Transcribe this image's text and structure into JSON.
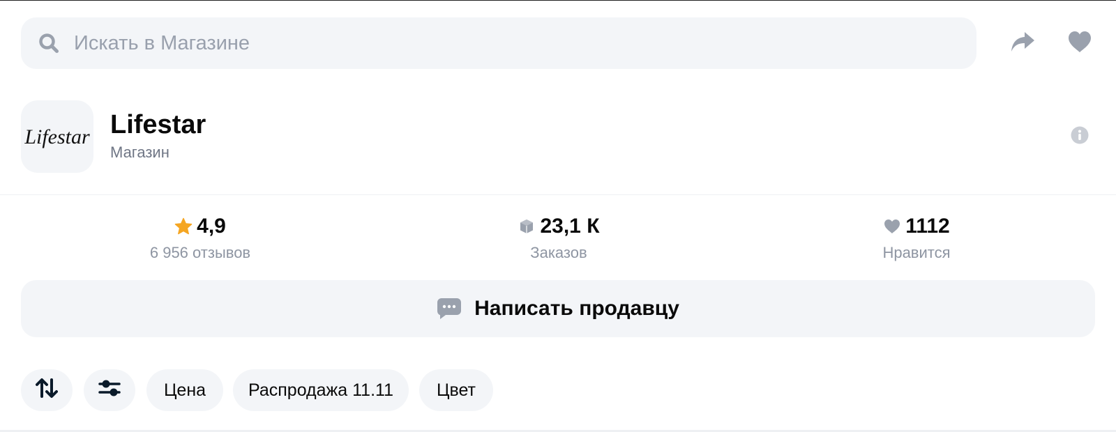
{
  "search": {
    "placeholder": "Искать в Магазине"
  },
  "header_actions": {
    "share_icon": "share-arrow-icon",
    "favorite_icon": "heart-icon"
  },
  "shop": {
    "logo_text": "Lifestar",
    "name": "Lifestar",
    "type": "Магазин",
    "info_icon": "info-icon"
  },
  "stats": {
    "rating": {
      "value": "4,9",
      "label": "6 956 отзывов",
      "icon": "star-icon",
      "color": "#f5a623"
    },
    "orders": {
      "value": "23,1 К",
      "label": "Заказов",
      "icon": "box-icon"
    },
    "likes": {
      "value": "1112",
      "label": "Нравится",
      "icon": "heart-icon"
    }
  },
  "write_seller": {
    "label": "Написать продавцу",
    "icon": "chat-icon"
  },
  "filters": {
    "sort_icon": "sort-arrows-icon",
    "filter_icon": "sliders-icon",
    "chips": [
      "Цена",
      "Распродажа 11.11",
      "Цвет"
    ]
  },
  "colors": {
    "surface": "#f3f5f8",
    "icon_gray": "#99a0ad",
    "text_secondary": "#6f7685",
    "star": "#f5a623"
  }
}
